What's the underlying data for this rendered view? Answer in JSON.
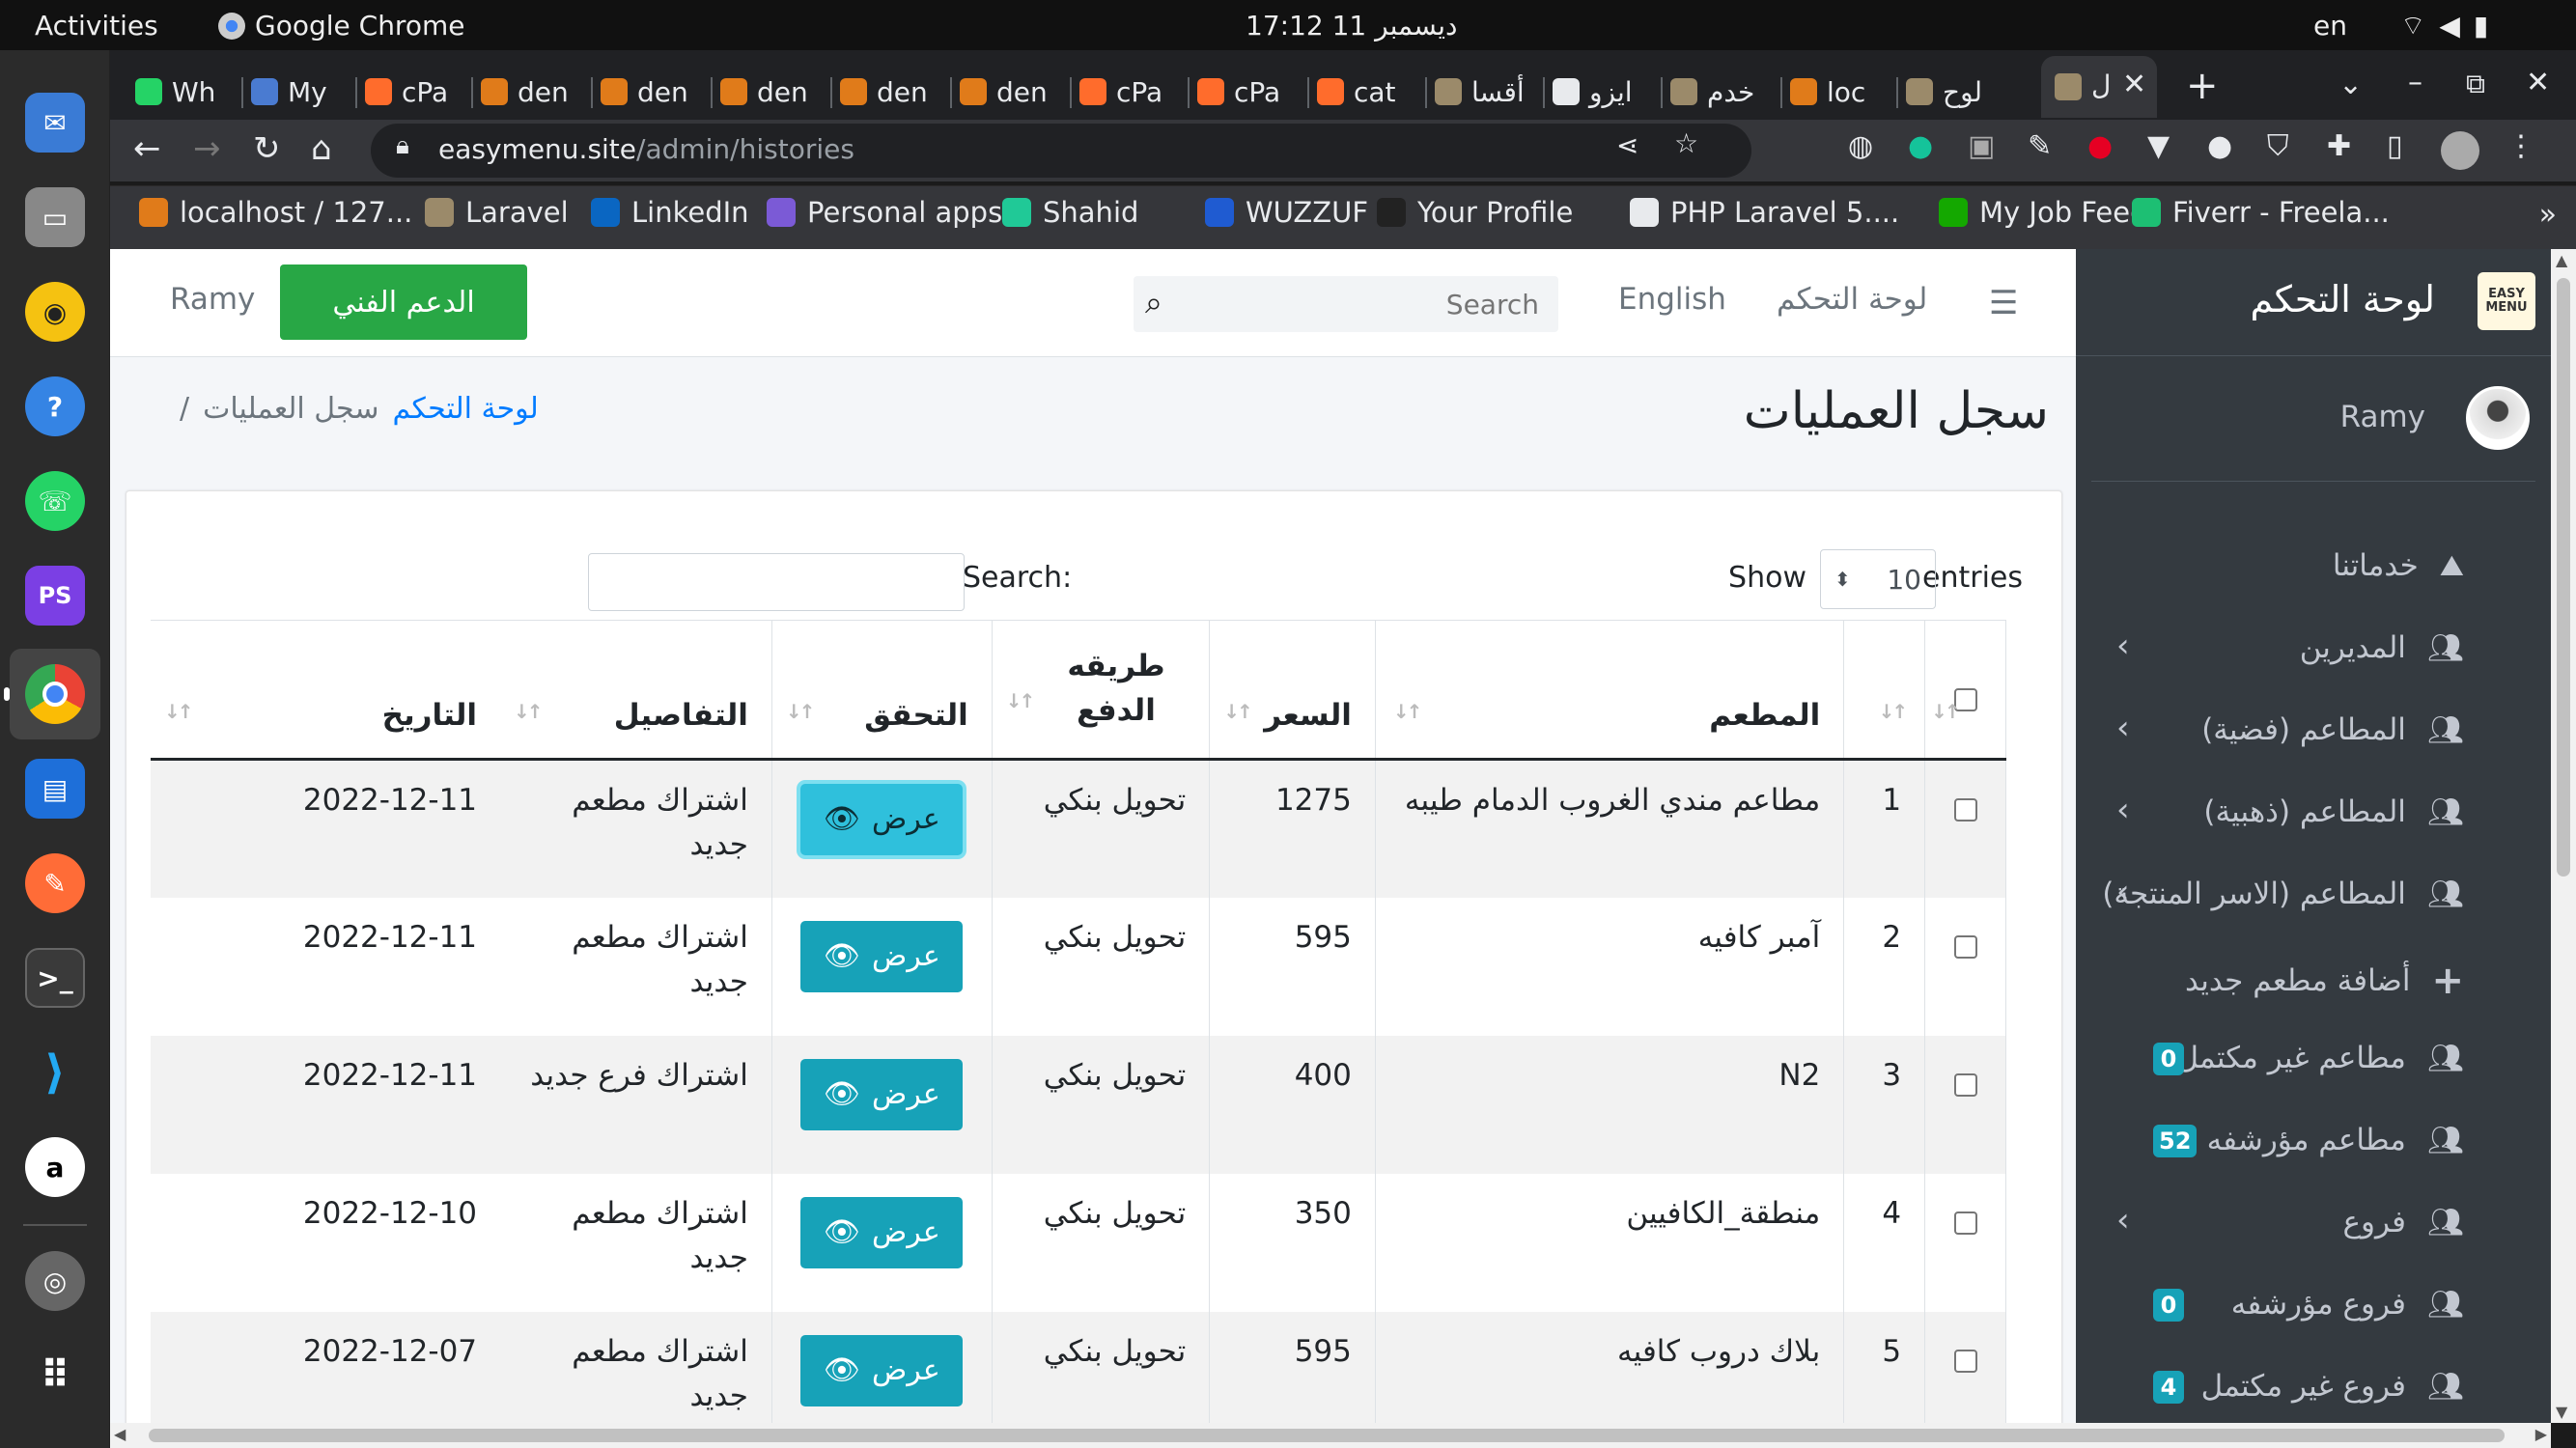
{
  "os_bar": {
    "activities": "Activities",
    "app_name": "Google Chrome",
    "clock": "17:12  11 ديسمبر",
    "lang": "en"
  },
  "dock": {
    "items": [
      "thunderbird-icon",
      "files-icon",
      "rhythmbox-icon",
      "help-icon",
      "whatsapp-icon",
      "phpstorm-icon",
      "chrome-icon",
      "libreoffice-writer-icon",
      "postman-icon",
      "terminal-icon",
      "vscode-icon",
      "anydesk-icon",
      "trash-icon",
      "app-grid-icon"
    ]
  },
  "tabs": [
    {
      "label": "Wh",
      "color": "#25d366"
    },
    {
      "label": "My",
      "color": "#4a7bd1"
    },
    {
      "label": "cPa",
      "color": "#ff6c2c"
    },
    {
      "label": "den",
      "color": "#e07b1a"
    },
    {
      "label": "den",
      "color": "#e07b1a"
    },
    {
      "label": "den",
      "color": "#e07b1a"
    },
    {
      "label": "den",
      "color": "#e07b1a"
    },
    {
      "label": "den",
      "color": "#e07b1a"
    },
    {
      "label": "cPa",
      "color": "#ff6c2c"
    },
    {
      "label": "cPa",
      "color": "#ff6c2c"
    },
    {
      "label": "cat",
      "color": "#ff6c2c"
    },
    {
      "label": "أقسا",
      "color": "#9b8a6a"
    },
    {
      "label": "ايزو",
      "color": "#e8eaed"
    },
    {
      "label": "خدم",
      "color": "#9b8a6a"
    },
    {
      "label": "loc",
      "color": "#e07b1a"
    },
    {
      "label": "لوح",
      "color": "#9b8a6a"
    }
  ],
  "active_tab": {
    "label": "ل"
  },
  "url": {
    "host": "easymenu.site",
    "path": "/admin/histories"
  },
  "bookmarks": [
    {
      "label": "localhost / 127...",
      "color": "#e07b1a"
    },
    {
      "label": "Laravel",
      "color": "#9b8a6a"
    },
    {
      "label": "LinkedIn",
      "color": "#0a66c2"
    },
    {
      "label": "Personal apps...",
      "color": "#7b5ad6"
    },
    {
      "label": "Shahid",
      "color": "#20c997"
    },
    {
      "label": "WUZZUF",
      "color": "#1f5bd1"
    },
    {
      "label": "Your Profile",
      "color": "#222222"
    },
    {
      "label": "PHP Laravel 5....",
      "color": "#e8eaed"
    },
    {
      "label": "My Job Feed",
      "color": "#14a800"
    },
    {
      "label": "Fiverr - Freela...",
      "color": "#1dbf73"
    }
  ],
  "navbar": {
    "brand_link": "لوحة التحكم",
    "language": "English",
    "search_placeholder": "Search",
    "support_button": "الدعم الفني",
    "user": "Ramy"
  },
  "sidebar": {
    "title": "لوحة التحكم",
    "logo_text": "EASY MENU",
    "user": "Ramy",
    "items": [
      {
        "label": "خدماتنا",
        "icon": "services-icon",
        "chevron": false,
        "badge": ""
      },
      {
        "label": "المديرين",
        "icon": "users-icon",
        "chevron": true,
        "badge": ""
      },
      {
        "label": "المطاعم (فضية)",
        "icon": "users-icon",
        "chevron": true,
        "badge": ""
      },
      {
        "label": "المطاعم (ذهبية)",
        "icon": "users-icon",
        "chevron": true,
        "badge": ""
      },
      {
        "label": "المطاعم (الاسر المنتجة)",
        "icon": "users-icon",
        "chevron": true,
        "badge": ""
      },
      {
        "label": "أضافة مطعم جديد",
        "icon": "plus-icon",
        "chevron": false,
        "badge": ""
      },
      {
        "label": "مطاعم غير مكتمل",
        "icon": "users-icon",
        "chevron": false,
        "badge": "0"
      },
      {
        "label": "مطاعم مؤرشفه",
        "icon": "users-icon",
        "chevron": false,
        "badge": "52"
      },
      {
        "label": "فروع",
        "icon": "users-icon",
        "chevron": true,
        "badge": ""
      },
      {
        "label": "فروع مؤرشفه",
        "icon": "users-icon",
        "chevron": false,
        "badge": "0"
      },
      {
        "label": "فروع غير مكتمل",
        "icon": "users-icon",
        "chevron": false,
        "badge": "4"
      }
    ],
    "badge_color": "#17a2b8"
  },
  "content": {
    "page_title": "سجل العمليات",
    "breadcrumb_home": "لوحة التحكم",
    "breadcrumb_current": "سجل العمليات",
    "breadcrumb_sep": "/"
  },
  "datatable": {
    "show_label": "Show",
    "entries_value": "10",
    "entries_label": "entries",
    "search_label": "Search:",
    "columns": [
      "",
      "",
      "المطعم",
      "السعر",
      "طريقه الدفع",
      "التحقق",
      "التفاصيل",
      "التاريخ"
    ],
    "view_label": "عرض",
    "rows": [
      {
        "num": "1",
        "restaurant": "مطاعم مندي الغروب الدمام طيبه",
        "price": "1275",
        "payment": "تحويل بنكي",
        "details": "اشتراك مطعم جديد",
        "date": "2022-12-11"
      },
      {
        "num": "2",
        "restaurant": "آمبر كافيه",
        "price": "595",
        "payment": "تحويل بنكي",
        "details": "اشتراك مطعم جديد",
        "date": "2022-12-11"
      },
      {
        "num": "3",
        "restaurant": "N2",
        "price": "400",
        "payment": "تحويل بنكي",
        "details": "اشتراك فرع جديد",
        "date": "2022-12-11"
      },
      {
        "num": "4",
        "restaurant": "منطقة_الكافيين",
        "price": "350",
        "payment": "تحويل بنكي",
        "details": "اشتراك مطعم جديد",
        "date": "2022-12-10"
      },
      {
        "num": "5",
        "restaurant": "بلاك دروب كافيه",
        "price": "595",
        "payment": "تحويل بنكي",
        "details": "اشتراك مطعم جديد",
        "date": "2022-12-07"
      }
    ]
  },
  "colors": {
    "primary_link": "#007bff",
    "success": "#28a745",
    "info": "#17a2b8",
    "sidebar_bg": "#343a40"
  }
}
